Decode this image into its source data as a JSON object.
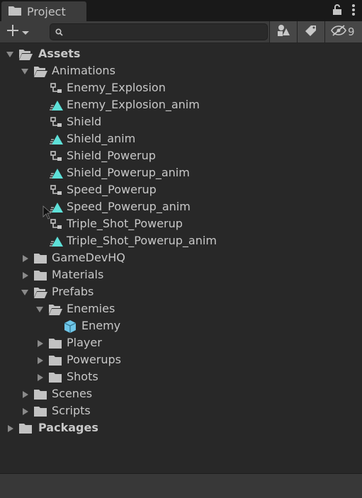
{
  "window": {
    "tab_title": "Project",
    "hidden_count": "9"
  },
  "search": {
    "value": "",
    "placeholder": ""
  },
  "colors": {
    "folder": "#c2c2c2",
    "anim_clip": "#5ee0d8",
    "prefab": "#6ec6e8",
    "controller": "#bdbdbd"
  },
  "tree": {
    "assets": "Assets",
    "animations": "Animations",
    "enemy_explosion": "Enemy_Explosion",
    "enemy_explosion_anim": "Enemy_Explosion_anim",
    "shield": "Shield",
    "shield_anim": "Shield_anim",
    "shield_powerup": "Shield_Powerup",
    "shield_powerup_anim": "Shield_Powerup_anim",
    "speed_powerup": "Speed_Powerup",
    "speed_powerup_anim": "Speed_Powerup_anim",
    "triple_shot_powerup": "Triple_Shot_Powerup",
    "triple_shot_powerup_anim": "Triple_Shot_Powerup_anim",
    "gamedevhq": "GameDevHQ",
    "materials": "Materials",
    "prefabs": "Prefabs",
    "enemies": "Enemies",
    "enemy": "Enemy",
    "player": "Player",
    "powerups": "Powerups",
    "shots": "Shots",
    "scenes": "Scenes",
    "scripts": "Scripts",
    "packages": "Packages"
  }
}
